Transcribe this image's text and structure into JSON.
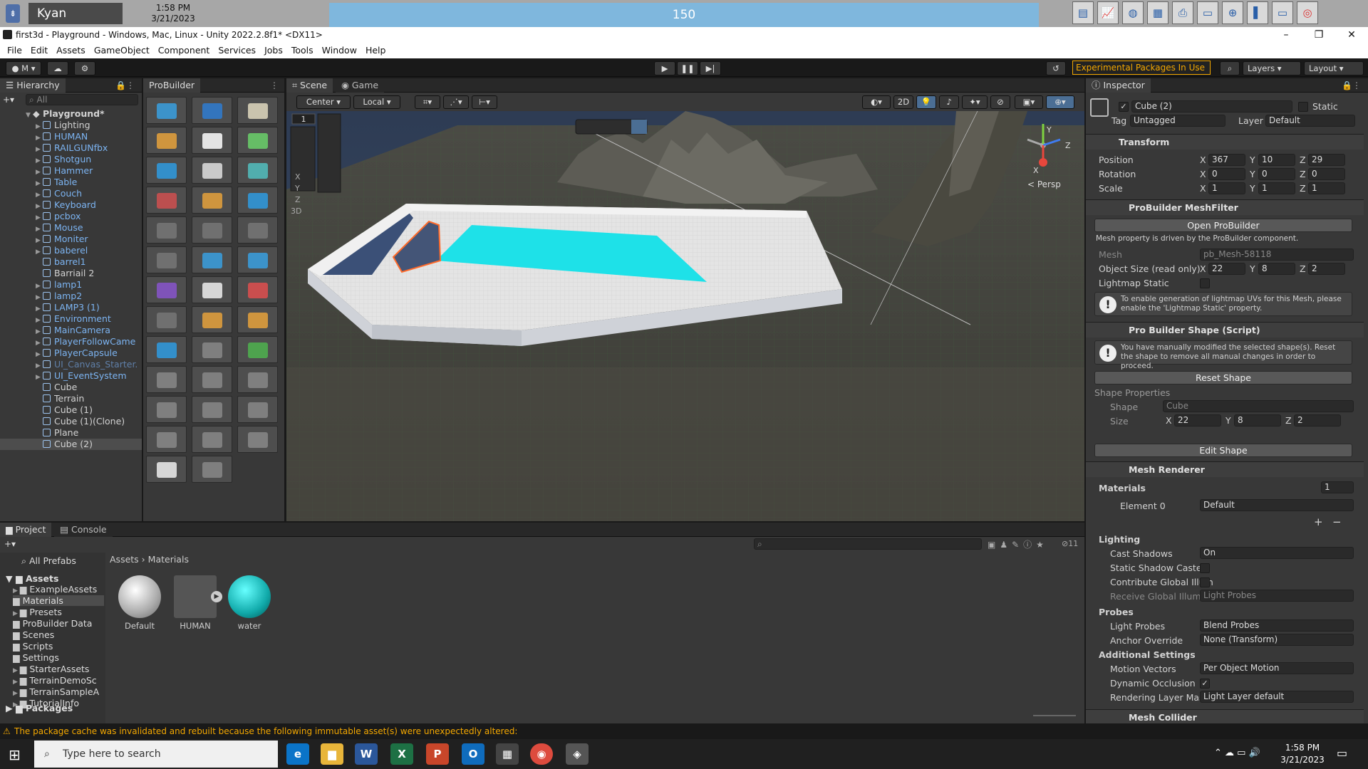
{
  "topstrip": {
    "user": "Kyan Haggerty",
    "time": "1:58 PM",
    "date": "3/21/2023",
    "counter": "150"
  },
  "window": {
    "title": "first3d - Playground - Windows, Mac, Linux - Unity 2022.2.8f1* <DX11>",
    "min": "–",
    "max": "❐",
    "close": "✕"
  },
  "menu": [
    "File",
    "Edit",
    "Assets",
    "GameObject",
    "Component",
    "Services",
    "Jobs",
    "Tools",
    "Window",
    "Help"
  ],
  "toolbar": {
    "account": "M",
    "experimental": "Experimental Packages In Use ▾",
    "layers": "Layers",
    "layout": "Layout"
  },
  "hierarchy": {
    "title": "Hierarchy",
    "search_placeholder": "All",
    "scene": "Playground*",
    "items": [
      "Lighting",
      "HUMAN",
      "RAILGUNfbx",
      "Shotgun",
      "Hammer",
      "Table",
      "Couch",
      "Keyboard",
      "pcbox",
      "Mouse",
      "Moniter",
      "baberel",
      "barrel1",
      "Barriail 2",
      "lamp1",
      "lamp2",
      "LAMP3 (1)",
      "Environment",
      "MainCamera",
      "PlayerFollowCame",
      "PlayerCapsule",
      "UI_Canvas_Starter.",
      "UI_EventSystem",
      "Cube",
      "Terrain",
      "Cube (1)",
      "Cube (1)(Clone)",
      "Plane",
      "Cube (2)"
    ]
  },
  "probuilder": {
    "title": "ProBuilder"
  },
  "scene": {
    "tab_scene": "Scene",
    "tab_game": "Game",
    "pivot": "Center",
    "space": "Local",
    "mode2d": "2D",
    "persp": "< Persp",
    "axis_x": "X",
    "axis_z": "Z",
    "axis_y": "Y"
  },
  "inspector": {
    "title": "Inspector",
    "object": "Cube (2)",
    "static": "Static",
    "tag_label": "Tag",
    "tag": "Untagged",
    "layer_label": "Layer",
    "layer": "Default",
    "transform": {
      "title": "Transform",
      "position": "Position",
      "rotation": "Rotation",
      "scale": "Scale",
      "px": "367",
      "py": "10",
      "pz": "29",
      "rx": "0",
      "ry": "0",
      "rz": "0",
      "sx": "1",
      "sy": "1",
      "sz": "1",
      "X": "X",
      "Y": "Y",
      "Z": "Z"
    },
    "meshfilter": {
      "title": "ProBuilder MeshFilter",
      "open": "Open ProBuilder",
      "note": "Mesh property is driven by the ProBuilder component.",
      "mesh_label": "Mesh",
      "mesh": "pb_Mesh-58118",
      "size_label": "Object Size (read only)",
      "sx": "22",
      "sy": "8",
      "sz": "2",
      "lightmap": "Lightmap Static",
      "warn": "To enable generation of lightmap UVs for this Mesh, please enable the 'Lightmap Static' property."
    },
    "shape": {
      "title": "Pro Builder Shape (Script)",
      "warn": "You have manually modified the selected shape(s). Reset the shape to remove all manual changes in order to proceed.",
      "reset": "Reset Shape",
      "props": "Shape Properties",
      "shape_label": "Shape",
      "shape": "Cube",
      "size_label": "Size",
      "sx": "22",
      "sy": "8",
      "sz": "2",
      "edit": "Edit Shape"
    },
    "renderer": {
      "title": "Mesh Renderer",
      "materials": "Materials",
      "count": "1",
      "element": "Element 0",
      "material": "Default",
      "plus": "+",
      "minus": "−",
      "lighting": "Lighting",
      "cast": "Cast Shadows",
      "cast_val": "On",
      "static_caster": "Static Shadow Caster",
      "contrib": "Contribute Global Illum",
      "receive": "Receive Global Illumin",
      "receive_val": "Light Probes",
      "probes": "Probes",
      "lightprobes": "Light Probes",
      "lightprobes_val": "Blend Probes",
      "anchor": "Anchor Override",
      "anchor_val": "None (Transform)",
      "additional": "Additional Settings",
      "motion": "Motion Vectors",
      "motion_val": "Per Object Motion",
      "occlusion": "Dynamic Occlusion",
      "rlm": "Rendering Layer Mask",
      "rlm_val": "Light Layer default"
    },
    "collider": {
      "title": "Mesh Collider"
    }
  },
  "project": {
    "tab_project": "Project",
    "tab_console": "Console",
    "favorites": "All Prefabs",
    "assets": "Assets",
    "folders": [
      "ExampleAssets",
      "Materials",
      "Presets",
      "ProBuilder Data",
      "Scenes",
      "Scripts",
      "Settings",
      "StarterAssets",
      "TerrainDemoSc",
      "TerrainSampleA",
      "TutorialInfo"
    ],
    "packages": "Packages",
    "crumb_root": "Assets",
    "crumb_sep": "›",
    "crumb_leaf": "Materials",
    "hidden_count": "11",
    "items": [
      {
        "name": "Default"
      },
      {
        "name": "HUMAN"
      },
      {
        "name": "water"
      }
    ]
  },
  "status": "The package cache was invalidated and rebuilt because the following immutable asset(s) were unexpectedly altered:",
  "taskbar": {
    "search": "Type here to search",
    "time": "1:58 PM",
    "date": "3/21/2023",
    "word": "W",
    "excel": "X",
    "ppt": "P",
    "outlook": "O"
  },
  "colors": {
    "unity_blue": "#7cb4f2",
    "water": "#1ee1e8",
    "warning": "#f4a800"
  }
}
